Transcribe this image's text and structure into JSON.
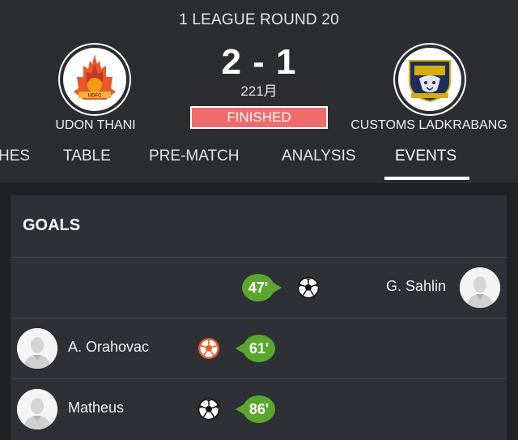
{
  "match": {
    "competition_round": "1 LEAGUE ROUND 20",
    "home_team": {
      "name": "UDON THANI",
      "logo_icon": "udon-thani-crest"
    },
    "away_team": {
      "name": "CUSTOMS LADKRABANG",
      "logo_icon": "customs-ladkrabang-crest"
    },
    "score": "2 - 1",
    "date": "221月",
    "status": "FINISHED"
  },
  "tabs": [
    {
      "label": "HES",
      "active": false
    },
    {
      "label": "TABLE",
      "active": false
    },
    {
      "label": "PRE-MATCH",
      "active": false
    },
    {
      "label": "ANALYSIS",
      "active": false
    },
    {
      "label": "EVENTS",
      "active": true
    }
  ],
  "events": {
    "section_title": "GOALS",
    "goals": [
      {
        "side": "away",
        "minute": "47'",
        "player": "G. Sahlin",
        "icon": "soccer-ball-icon"
      },
      {
        "side": "home",
        "minute": "61'",
        "player": "A. Orahovac",
        "icon": "own-goal-ball-icon"
      },
      {
        "side": "home",
        "minute": "86'",
        "player": "Matheus",
        "icon": "soccer-ball-icon"
      }
    ]
  },
  "colors": {
    "background": "#2b2d31",
    "content_background": "#1f2125",
    "card_background": "#2d3034",
    "status_badge": "#f06b6b",
    "minute_badge": "#5aa72e",
    "own_goal_ball": "#e8582a"
  }
}
